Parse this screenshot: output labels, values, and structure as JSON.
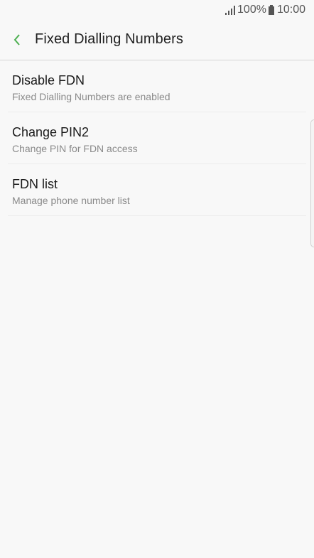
{
  "status_bar": {
    "battery": "100%",
    "time": "10:00",
    "icons": [
      "signal-icon",
      "battery-icon"
    ]
  },
  "header": {
    "title": "Fixed Dialling Numbers",
    "back_icon": "chevron-left-icon",
    "accent_color": "#4caf50"
  },
  "list": {
    "items": [
      {
        "title": "Disable FDN",
        "subtitle": "Fixed Dialling Numbers are enabled"
      },
      {
        "title": "Change PIN2",
        "subtitle": "Change PIN for FDN access"
      },
      {
        "title": "FDN list",
        "subtitle": "Manage phone number list"
      }
    ]
  }
}
